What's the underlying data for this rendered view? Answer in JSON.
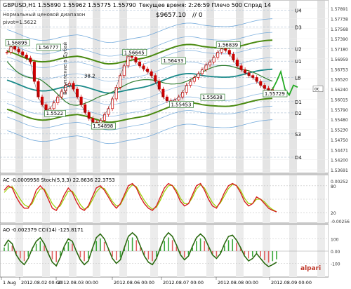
{
  "window": {
    "symbol_line": "GBPUSD,H1  1.55890 1.55962 1.55775 1.55790",
    "range_label": "Нормальный ценовой диапазон",
    "pivot_label": "pivot=1.5622",
    "time_label": "Текущее время: 2:26:59 Плечо 500 Спрэд 14",
    "balance_label": "$9657.10",
    "zero_label": "// 0"
  },
  "colors": {
    "candle": "#cc0000",
    "price_line": "#1a1a1a",
    "ma_thick": "#4a8a10",
    "ma_teal": "#1a8a8a",
    "envelope": "#5b9bd5",
    "forecast": "#22aa22",
    "stoch_main": "#d62020",
    "stoch_signal": "#9ad000",
    "cci_line": "#2a6a10",
    "ao_up": "#3aa83a",
    "ao_down": "#e06060",
    "label_border": "#2a7a2a"
  },
  "price_panel": {
    "price_labels": [
      "1.57891",
      "1.57738",
      "1.57568",
      "1.57390",
      "1.57180",
      "1.56959",
      "1.56753",
      "1.56520",
      "1.56240",
      "1.56015",
      "1.55790",
      "1.55480",
      "1.55230",
      "1.54750",
      "1.54471",
      "1.54200",
      "1.53691"
    ],
    "levels": [
      {
        "name": "U4",
        "price": 1.5783
      },
      {
        "name": "D3",
        "price": 1.574
      },
      {
        "name": "U2",
        "price": 1.5684
      },
      {
        "name": "U1",
        "price": 1.5652
      },
      {
        "name": "LB",
        "price": 1.561
      },
      {
        "name": "D1",
        "price": 1.5548
      },
      {
        "name": "D2",
        "price": 1.5519
      },
      {
        "name": "S3",
        "price": 1.5465
      },
      {
        "name": "D4",
        "price": 1.5405
      }
    ],
    "annotations": [
      {
        "text": "1.56895"
      },
      {
        "text": "1.56777"
      },
      {
        "text": "1.56645"
      },
      {
        "text": "1.56433"
      },
      {
        "text": "1.56839"
      },
      {
        "text": "1.5522"
      },
      {
        "text": "1.54898"
      },
      {
        "text": "1.55453"
      },
      {
        "text": "1.55638"
      },
      {
        "text": "1.55729"
      }
    ],
    "small_labels": [
      "38.2",
      "oc"
    ],
    "vertical_text": "Вступление в Дубай"
  },
  "stoch_panel": {
    "header": "AC -0.0009958  Stoch(5,3,3) 22.8636 22.3753",
    "right_labels": [
      "80",
      "20",
      "0.00252",
      "-0.00256"
    ]
  },
  "cci_panel": {
    "header": "AO -0.002379  CCI(14) -125.8171",
    "right_labels": [
      "100",
      "-100",
      "0.00"
    ],
    "watermark": "alpari"
  },
  "time_axis": {
    "labels": [
      "1 Aug",
      "2012.08.02 00:00",
      "2012.08.03 00:00",
      "2012.08.06 00:00",
      "2012.08.07 00:00",
      "2012.08.08 00:00",
      "2012.08.09 00:00"
    ]
  },
  "chart_data": {
    "type": "candlestick",
    "symbol": "GBPUSD",
    "timeframe": "H1",
    "ohlc_current": {
      "open": 1.5589,
      "high": 1.55962,
      "low": 1.55775,
      "close": 1.5579
    },
    "ylim": [
      1.5369,
      1.5795
    ],
    "close_series": [
      1.5675,
      1.569,
      1.5683,
      1.5676,
      1.5668,
      1.566,
      1.565,
      1.56,
      1.556,
      1.554,
      1.5525,
      1.553,
      1.5545,
      1.556,
      1.5575,
      1.559,
      1.5595,
      1.558,
      1.556,
      1.554,
      1.552,
      1.5505,
      1.5495,
      1.549,
      1.55,
      1.5515,
      1.553,
      1.5555,
      1.5585,
      1.5615,
      1.564,
      1.5665,
      1.5662,
      1.565,
      1.564,
      1.5632,
      1.5625,
      1.5615,
      1.56,
      1.558,
      1.556,
      1.555,
      1.5548,
      1.5552,
      1.556,
      1.5572,
      1.559,
      1.56,
      1.561,
      1.562,
      1.563,
      1.5642,
      1.565,
      1.5662,
      1.5675,
      1.5684,
      1.568,
      1.567,
      1.5655,
      1.564,
      1.563,
      1.5622,
      1.5615,
      1.561,
      1.56,
      1.559,
      1.5582,
      1.5578,
      1.5579
    ],
    "forecast": [
      1.5579,
      1.56,
      1.5625,
      1.558,
      1.5565,
      1.559,
      1.5585
    ],
    "stochastic": {
      "main": [
        70,
        80,
        75,
        55,
        40,
        30,
        30,
        45,
        70,
        80,
        70,
        50,
        30,
        25,
        40,
        60,
        75,
        65,
        45,
        30,
        25,
        35,
        55,
        75,
        80,
        70,
        55,
        40,
        30,
        40,
        60,
        80,
        85,
        75,
        55,
        40,
        30,
        25,
        35,
        55,
        75,
        85,
        80,
        65,
        45,
        35,
        40,
        60,
        80,
        85,
        70,
        50,
        35,
        30,
        45,
        65,
        80,
        85,
        80,
        65,
        45,
        35,
        40,
        55,
        50,
        40,
        30,
        25,
        22
      ],
      "signal": [
        65,
        75,
        78,
        65,
        50,
        38,
        33,
        40,
        60,
        73,
        73,
        57,
        40,
        30,
        35,
        52,
        68,
        68,
        55,
        38,
        28,
        32,
        48,
        66,
        76,
        74,
        60,
        45,
        35,
        38,
        55,
        73,
        82,
        78,
        62,
        47,
        35,
        28,
        32,
        48,
        67,
        80,
        81,
        70,
        52,
        40,
        40,
        54,
        73,
        82,
        75,
        58,
        42,
        33,
        42,
        58,
        74,
        83,
        81,
        70,
        52,
        40,
        40,
        50,
        50,
        44,
        34,
        27,
        22
      ]
    },
    "cci": [
      40,
      90,
      60,
      -30,
      -80,
      -110,
      -60,
      20,
      80,
      110,
      60,
      -20,
      -90,
      -120,
      -50,
      40,
      100,
      80,
      0,
      -70,
      -110,
      -80,
      20,
      110,
      140,
      100,
      20,
      -60,
      -100,
      -70,
      30,
      120,
      150,
      120,
      40,
      -40,
      -90,
      -110,
      -60,
      30,
      110,
      150,
      120,
      50,
      -30,
      -70,
      -40,
      40,
      110,
      140,
      110,
      40,
      -30,
      -60,
      -20,
      60,
      120,
      130,
      90,
      30,
      -40,
      -80,
      -60,
      -20,
      -60,
      -100,
      -126,
      -110,
      -90
    ]
  }
}
